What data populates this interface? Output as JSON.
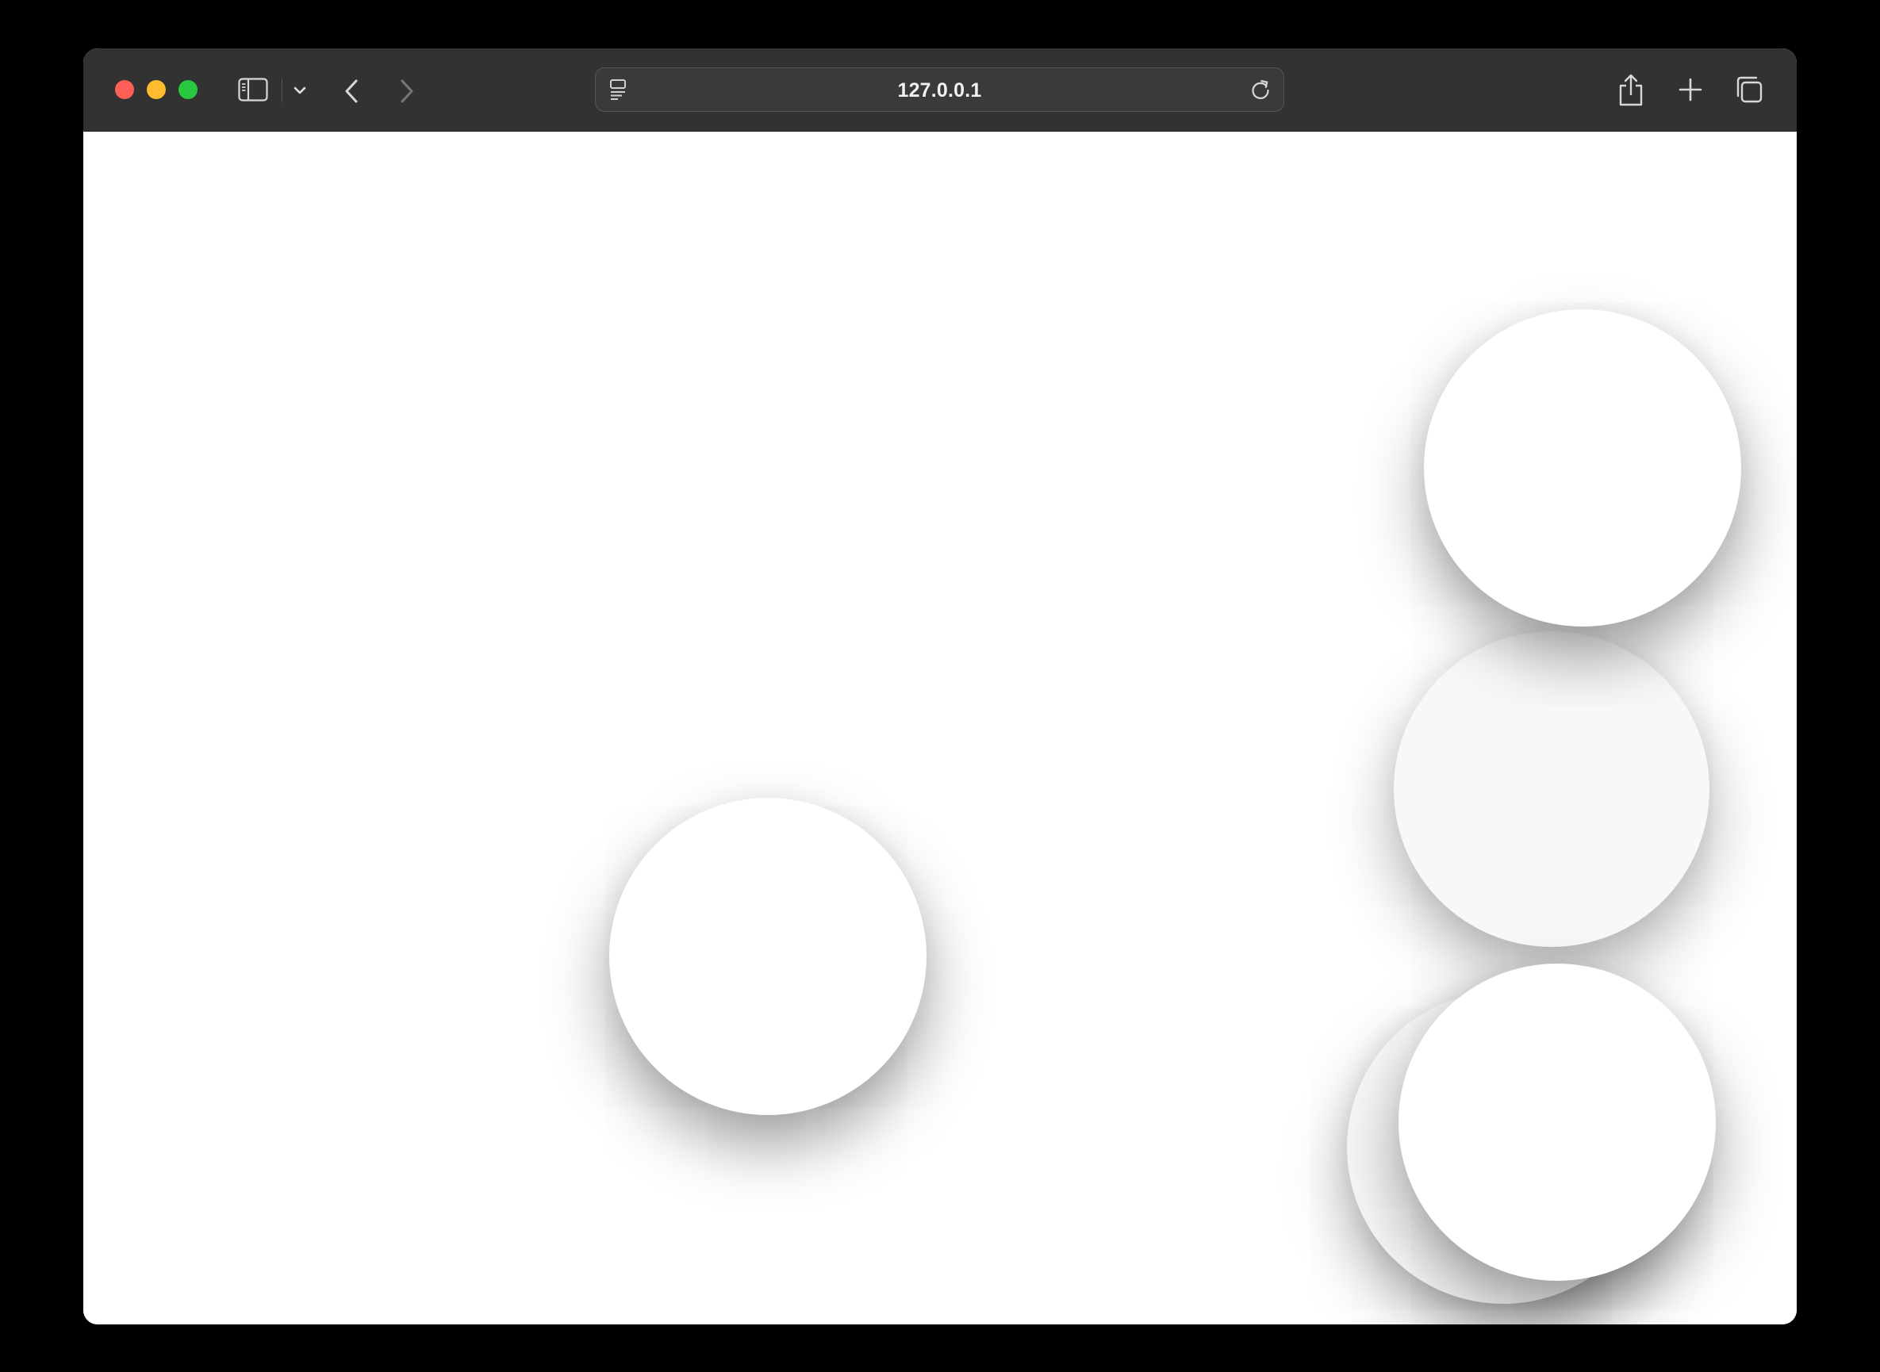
{
  "browser": {
    "address": "127.0.0.1",
    "colors": {
      "toolbar": "#323232",
      "close": "#fe5f57",
      "minimize": "#febc2e",
      "maximize": "#28c840",
      "content_background": "#ffffff"
    },
    "icons": {
      "sidebar": "sidebar-icon",
      "sidebar_menu": "chevron-down-icon",
      "back": "chevron-left-icon",
      "forward": "chevron-right-icon",
      "page": "page-menu-icon",
      "reload": "reload-icon",
      "share": "share-icon",
      "new_tab": "plus-icon",
      "tab_overview": "tabs-overview-icon"
    }
  },
  "canvas": {
    "disc_count": 5,
    "disc_color": "#ffffff"
  }
}
